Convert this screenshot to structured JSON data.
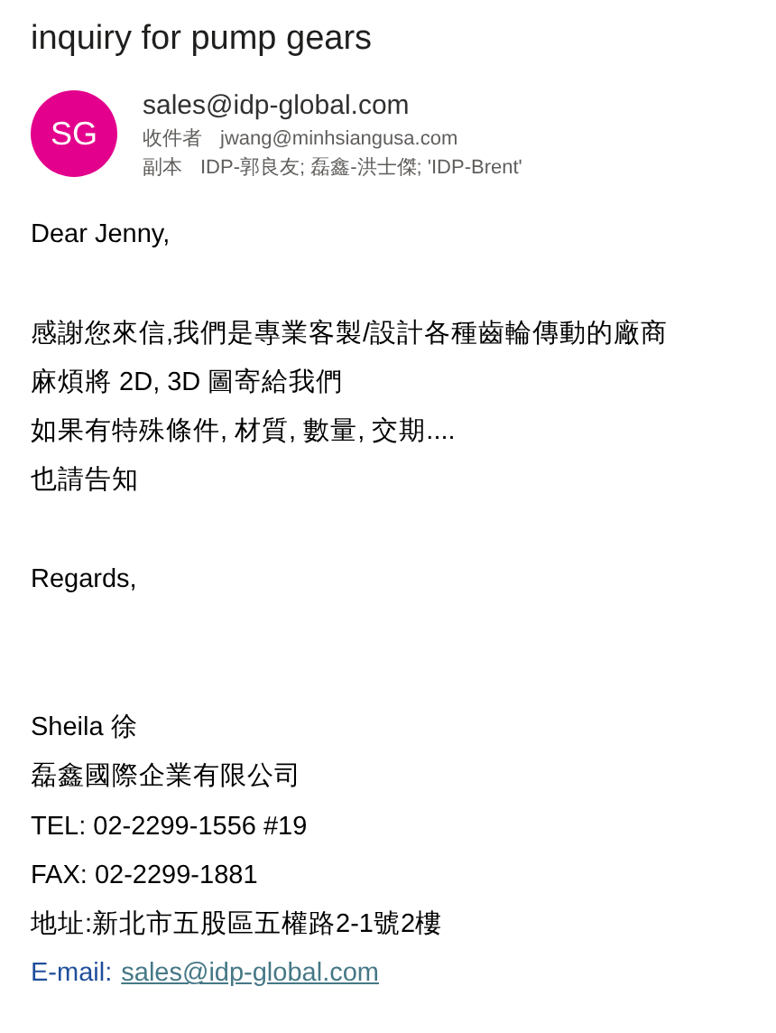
{
  "subject": "inquiry for pump gears",
  "sender": {
    "initials": "SG",
    "color": "#e3008c",
    "email": "sales@idp-global.com"
  },
  "to": {
    "label": "收件者",
    "value": "jwang@minhsiangusa.com"
  },
  "cc": {
    "label": "副本",
    "value": "IDP-郭良友; 磊鑫-洪士傑; 'IDP-Brent'"
  },
  "body": [
    {
      "kind": "text",
      "text": "Dear Jenny,"
    },
    {
      "kind": "blank"
    },
    {
      "kind": "text",
      "text": "感謝您來信,我們是專業客製/設計各種齒輪傳動的廠商"
    },
    {
      "kind": "text",
      "text": "麻煩將 2D, 3D 圖寄給我們"
    },
    {
      "kind": "text",
      "text": "如果有特殊條件, 材質, 數量, 交期...."
    },
    {
      "kind": "text",
      "text": "也請告知"
    },
    {
      "kind": "blank"
    },
    {
      "kind": "text",
      "text": "Regards,"
    },
    {
      "kind": "blank"
    },
    {
      "kind": "blank"
    },
    {
      "kind": "text",
      "text": "Sheila 徐"
    },
    {
      "kind": "text",
      "text": "磊鑫國際企業有限公司"
    },
    {
      "kind": "text",
      "text": "TEL: 02-2299-1556 #19"
    },
    {
      "kind": "text",
      "text": "FAX: 02-2299-1881"
    },
    {
      "kind": "text",
      "text": "地址:新北市五股區五權路2-1號2樓"
    },
    {
      "kind": "link",
      "label": "E-mail:",
      "link": "sales@idp-global.com"
    }
  ]
}
